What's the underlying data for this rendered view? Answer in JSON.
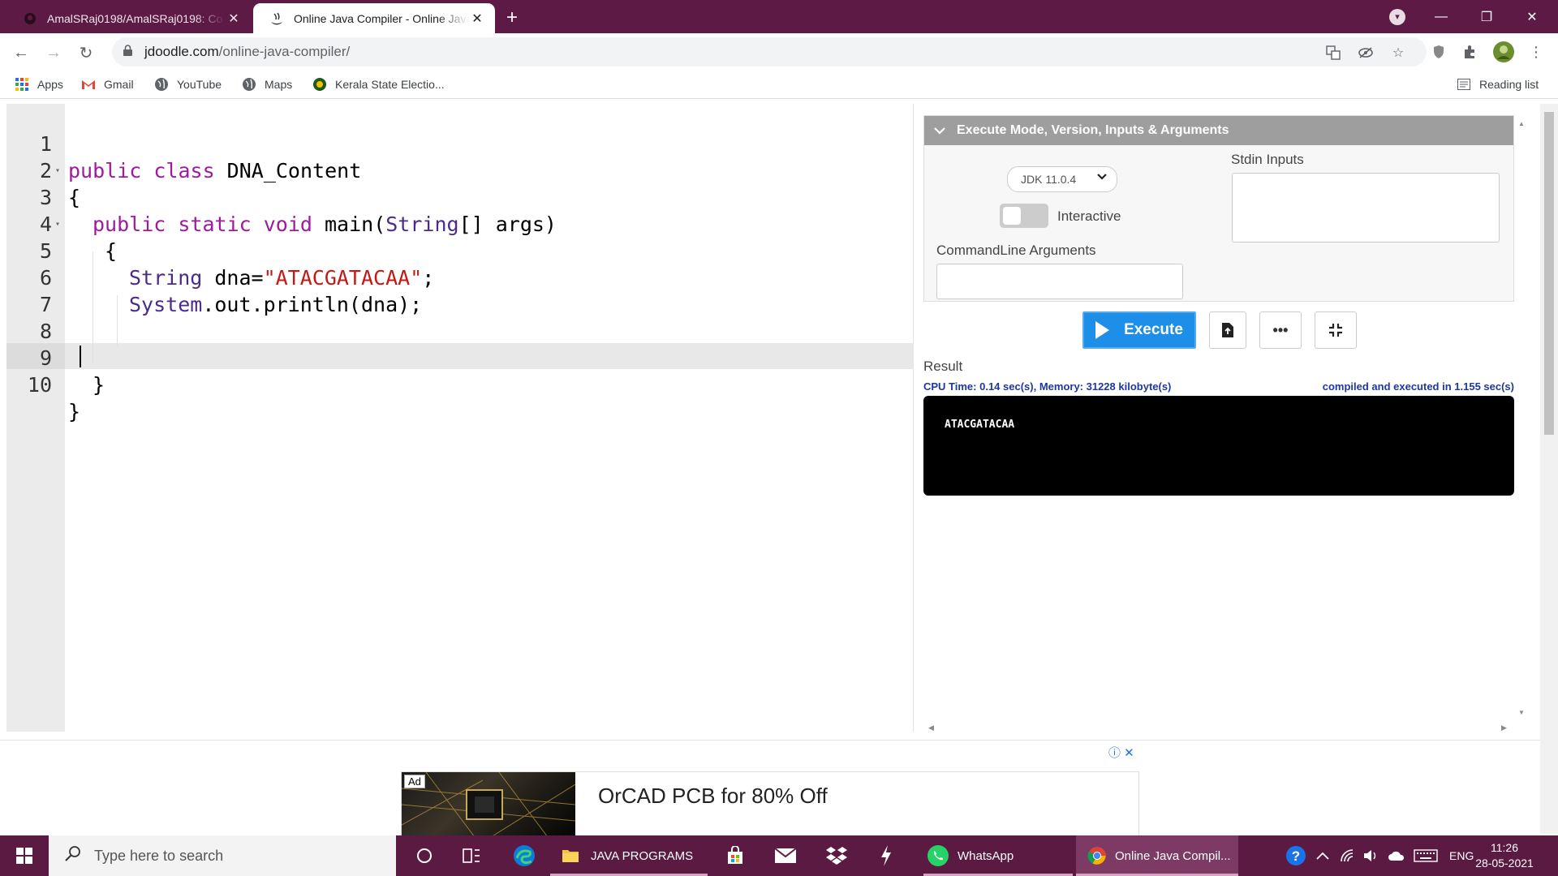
{
  "browser": {
    "tabs": [
      {
        "title": "AmalSRaj0198/AmalSRaj0198: Co",
        "active": false
      },
      {
        "title": "Online Java Compiler - Online Java",
        "active": true
      }
    ],
    "url_host": "jdoodle.com",
    "url_path": "/online-java-compiler/",
    "bookmarks": [
      "Apps",
      "Gmail",
      "YouTube",
      "Maps",
      "Kerala State Electio..."
    ],
    "reading_list": "Reading list"
  },
  "editor": {
    "line_numbers": [
      "1",
      "2",
      "3",
      "4",
      "5",
      "6",
      "7",
      "8",
      "9",
      "10"
    ],
    "tokens": {
      "l1_kw": "public class",
      "l1_name": " DNA_Content",
      "l2": "{",
      "l3_kw": "public static void",
      "l3_main": " main(",
      "l3_type": "String",
      "l3_rest": "[] args)",
      "l4": "{",
      "l5_type": "String",
      "l5_mid": " dna=",
      "l5_str": "\"ATACGATACAA\"",
      "l5_end": ";",
      "l6_type": "System",
      "l6_rest": ".out.println(dna);",
      "l9": "}",
      "l10": "}"
    }
  },
  "exec_panel": {
    "header": "Execute Mode, Version, Inputs & Arguments",
    "jdk_version": "JDK 11.0.4",
    "interactive_label": "Interactive",
    "stdin_label": "Stdin Inputs",
    "cmdline_label": "CommandLine Arguments",
    "execute_label": "Execute"
  },
  "result": {
    "label": "Result",
    "stats": "CPU Time: 0.14 sec(s), Memory: 31228 kilobyte(s)",
    "compile_info": "compiled and executed in 1.155 sec(s)",
    "output": "ATACGATACAA"
  },
  "ad": {
    "badge": "Ad",
    "text": "OrCAD PCB for 80% Off"
  },
  "taskbar": {
    "search_placeholder": "Type here to search",
    "apps": [
      "JAVA PROGRAMS",
      "WhatsApp",
      "Online Java Compil..."
    ],
    "language": "ENG",
    "time": "11:26",
    "date": "28-05-2021"
  }
}
